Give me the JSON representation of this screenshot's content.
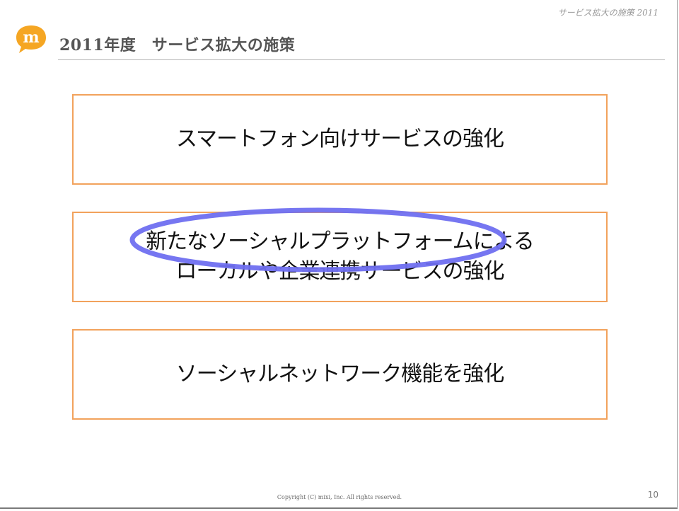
{
  "header": {
    "running_title": "サービス拡大の施策 2011",
    "title": "2011年度　サービス拡大の施策",
    "logo_letter": "m",
    "logo_icon": "mixi-logo-icon"
  },
  "boxes": [
    {
      "text": "スマートフォン向けサービスの強化"
    },
    {
      "text": "新たなソーシャルプラットフォームによる\nローカルや企業連携サービスの強化"
    },
    {
      "text": "ソーシャルネットワーク機能を強化"
    }
  ],
  "annotation": {
    "icon": "ellipse-highlight",
    "color": "#6f6ff0"
  },
  "colors": {
    "box_border": "#f2a25c",
    "logo": "#f5a623"
  },
  "footer": {
    "copyright": "Copyright (C) mixi, Inc. All rights reserved.",
    "page_number": "10"
  }
}
